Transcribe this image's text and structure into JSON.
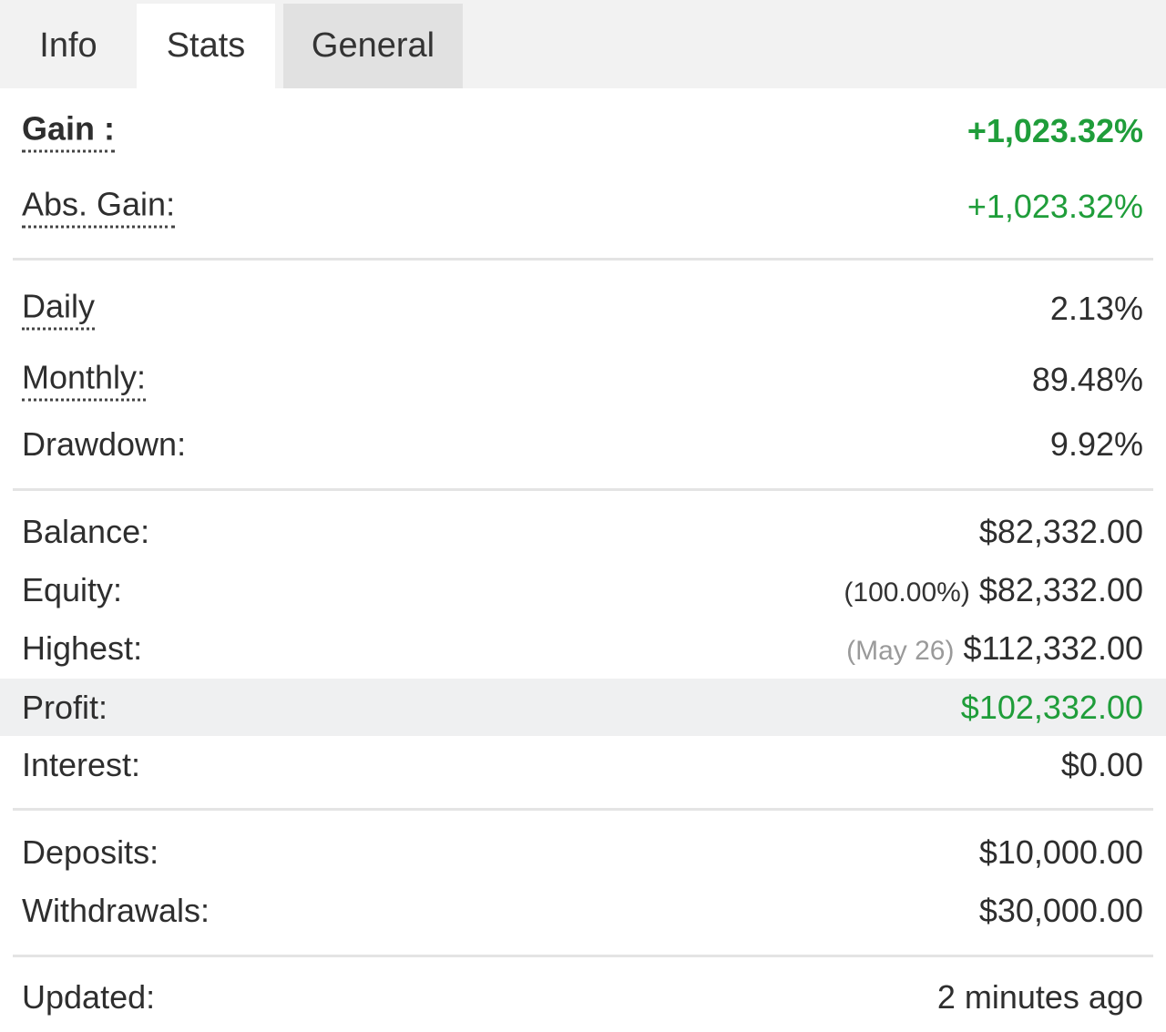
{
  "tabs": [
    {
      "label": "Info"
    },
    {
      "label": "Stats"
    },
    {
      "label": "General"
    }
  ],
  "gain": {
    "label": "Gain :",
    "value": "+1,023.32%"
  },
  "abs_gain": {
    "label": "Abs. Gain:",
    "value": "+1,023.32%"
  },
  "daily": {
    "label": "Daily",
    "value": "2.13%"
  },
  "monthly": {
    "label": "Monthly:",
    "value": "89.48%"
  },
  "drawdown": {
    "label": "Drawdown:",
    "value": "9.92%"
  },
  "balance": {
    "label": "Balance:",
    "value": "$82,332.00"
  },
  "equity": {
    "label": "Equity:",
    "note": "(100.00%)",
    "value": "$82,332.00"
  },
  "highest": {
    "label": "Highest:",
    "note": "(May 26)",
    "value": "$112,332.00"
  },
  "profit": {
    "label": "Profit:",
    "value": "$102,332.00"
  },
  "interest": {
    "label": "Interest:",
    "value": "$0.00"
  },
  "deposits": {
    "label": "Deposits:",
    "value": "$10,000.00"
  },
  "withdrawals": {
    "label": "Withdrawals:",
    "value": "$30,000.00"
  },
  "updated": {
    "label": "Updated:",
    "value": "2 minutes ago"
  },
  "colors": {
    "positive": "#1f9d3a",
    "highlight_row": "#eff0f1",
    "active_tab": "#ffffff",
    "hover_tab": "#e1e1e1"
  }
}
